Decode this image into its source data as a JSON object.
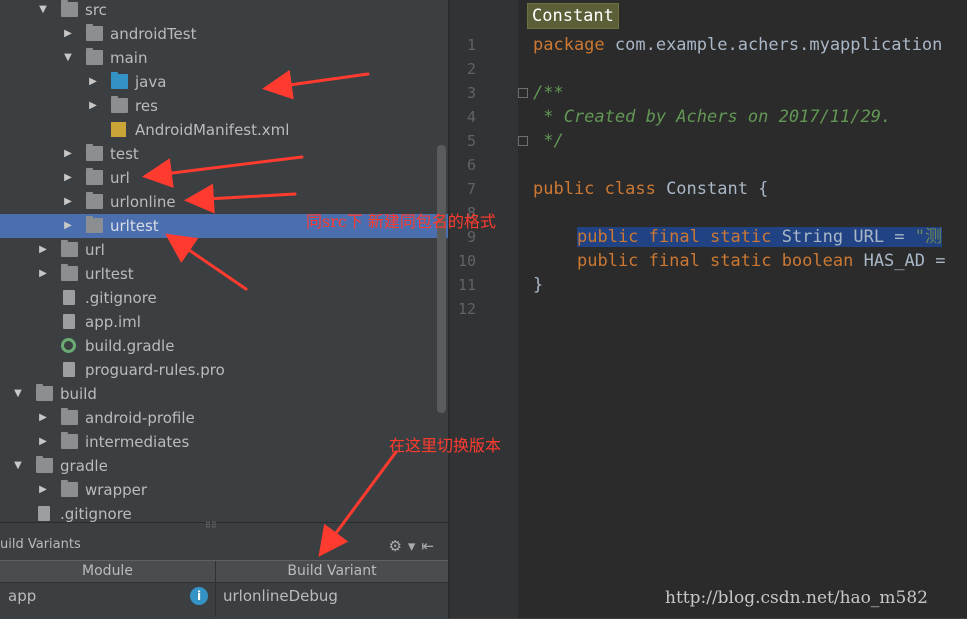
{
  "tree": [
    {
      "label": "src",
      "indent": 1,
      "arrow": "down",
      "icon": "folder",
      "selected": false
    },
    {
      "label": "androidTest",
      "indent": 2,
      "arrow": "right",
      "icon": "folder",
      "selected": false
    },
    {
      "label": "main",
      "indent": 2,
      "arrow": "down",
      "icon": "folder",
      "selected": false
    },
    {
      "label": "java",
      "indent": 3,
      "arrow": "right",
      "icon": "folder-blue",
      "selected": false
    },
    {
      "label": "res",
      "indent": 3,
      "arrow": "right",
      "icon": "folder-res",
      "selected": false
    },
    {
      "label": "AndroidManifest.xml",
      "indent": 3,
      "arrow": "none",
      "icon": "manifest",
      "selected": false
    },
    {
      "label": "test",
      "indent": 2,
      "arrow": "right",
      "icon": "folder",
      "selected": false
    },
    {
      "label": "url",
      "indent": 2,
      "arrow": "right",
      "icon": "folder",
      "selected": false
    },
    {
      "label": "urlonline",
      "indent": 2,
      "arrow": "right",
      "icon": "folder",
      "selected": false
    },
    {
      "label": "urltest",
      "indent": 2,
      "arrow": "right",
      "icon": "folder",
      "selected": true
    },
    {
      "label": "url",
      "indent": 1,
      "arrow": "right",
      "icon": "folder",
      "selected": false
    },
    {
      "label": "urltest",
      "indent": 1,
      "arrow": "right",
      "icon": "folder",
      "selected": false
    },
    {
      "label": ".gitignore",
      "indent": 1,
      "arrow": "none",
      "icon": "file",
      "selected": false
    },
    {
      "label": "app.iml",
      "indent": 1,
      "arrow": "none",
      "icon": "file",
      "selected": false
    },
    {
      "label": "build.gradle",
      "indent": 1,
      "arrow": "none",
      "icon": "gradle",
      "selected": false
    },
    {
      "label": "proguard-rules.pro",
      "indent": 1,
      "arrow": "none",
      "icon": "file",
      "selected": false
    },
    {
      "label": "build",
      "indent": 0,
      "arrow": "down",
      "icon": "folder",
      "selected": false
    },
    {
      "label": "android-profile",
      "indent": 1,
      "arrow": "right",
      "icon": "folder",
      "selected": false
    },
    {
      "label": "intermediates",
      "indent": 1,
      "arrow": "right",
      "icon": "folder",
      "selected": false
    },
    {
      "label": "gradle",
      "indent": 0,
      "arrow": "down",
      "icon": "folder",
      "selected": false
    },
    {
      "label": "wrapper",
      "indent": 1,
      "arrow": "right",
      "icon": "folder",
      "selected": false
    },
    {
      "label": ".gitignore",
      "indent": 0,
      "arrow": "none",
      "icon": "file",
      "selected": false
    }
  ],
  "build_variants": {
    "title": "uild Variants",
    "col_module": "Module",
    "col_variant": "Build Variant",
    "module": "app",
    "variant": "urlonlineDebug"
  },
  "editor": {
    "tab": "Constant",
    "line_numbers": [
      "1",
      "2",
      "3",
      "4",
      "5",
      "6",
      "7",
      "8",
      "9",
      "10",
      "11",
      "12"
    ],
    "lines": {
      "l1_kw": "package",
      "l1_rest": " com.example.achers.myapplication",
      "l3": "/**",
      "l4": " * Created by Achers on 2017/11/29.",
      "l5": " */",
      "l7_kw": "public class",
      "l7_rest": " Constant {",
      "l9_kw1": "public final static",
      "l9_rest": " String URL = ",
      "l9_str": "\"测",
      "l10_kw": "public final static boolean",
      "l10_rest": " HAS_AD =",
      "l11": "}"
    }
  },
  "annotations": {
    "note1": "同src下 新建同包名的格式",
    "note2": "在这里切换版本"
  },
  "watermark": "http://blog.csdn.net/hao_m582",
  "colors": {
    "selection": "#4b6eaf",
    "annotation": "#ff3b30",
    "keyword": "#cc7832",
    "comment": "#629755"
  }
}
